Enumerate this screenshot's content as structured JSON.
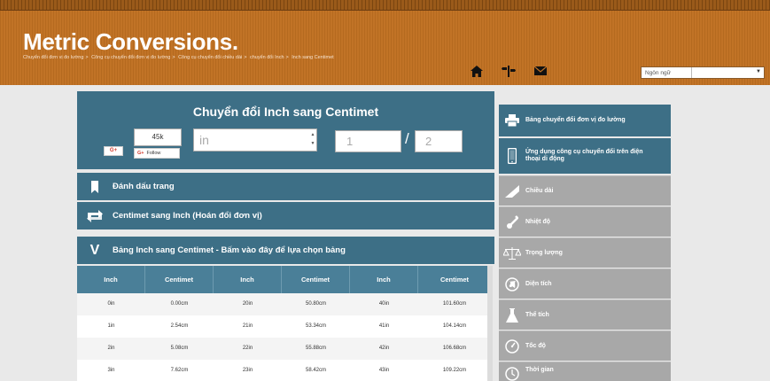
{
  "header": {
    "title": "Metric Conversions.",
    "breadcrumb": [
      "Chuyển đổi đơn vị đo lường",
      "Công cụ chuyển đổi đơn vị đo lường",
      "Công cụ chuyển đổi chiều dài",
      "chuyển đổi Inch",
      "Inch sang Centimet"
    ],
    "breadcrumb_sep": ">",
    "icons": [
      "home-icon",
      "signpost-icon",
      "mail-icon"
    ],
    "language_label": "Ngôn ngữ",
    "language_value": ""
  },
  "converter": {
    "title": "Chuyển đổi Inch sang Centimet",
    "share_count": "45k",
    "gplus_label": "G+",
    "follow_g": "G+",
    "follow_label": "Follow",
    "input_placeholder": "in",
    "numerator_placeholder": "1",
    "fraction_slash": "/",
    "denominator_placeholder": "2"
  },
  "bars": {
    "bookmark": "Đánh dấu trang",
    "swap": "Centimet sang Inch (Hoán đổi đơn vị)",
    "table_icon_letter": "V",
    "table": "Bảng Inch sang Centimet - Bấm vào đây để lựa chọn bảng"
  },
  "table": {
    "headers": [
      "Inch",
      "Centimet",
      "Inch",
      "Centimet",
      "Inch",
      "Centimet"
    ],
    "rows": [
      [
        "0in",
        "0.00cm",
        "20in",
        "50.80cm",
        "40in",
        "101.60cm"
      ],
      [
        "1in",
        "2.54cm",
        "21in",
        "53.34cm",
        "41in",
        "104.14cm"
      ],
      [
        "2in",
        "5.08cm",
        "22in",
        "55.88cm",
        "42in",
        "106.68cm"
      ],
      [
        "3in",
        "7.62cm",
        "23in",
        "58.42cm",
        "43in",
        "109.22cm"
      ]
    ]
  },
  "sidebar": {
    "items": [
      {
        "label": "Bảng chuyển đổi đơn vị đo lường",
        "icon": "printer-icon",
        "style": "blue"
      },
      {
        "label": "Ứng dụng công cụ chuyển đổi trên điện thoại di động",
        "icon": "phone-icon",
        "style": "blue"
      },
      {
        "label": "Chiều dài",
        "icon": "ruler-triangle-icon",
        "style": "gray"
      },
      {
        "label": "Nhiệt độ",
        "icon": "thermometer-icon",
        "style": "gray"
      },
      {
        "label": "Trọng lượng",
        "icon": "scales-icon",
        "style": "gray"
      },
      {
        "label": "Diện tích",
        "icon": "globe-icon",
        "style": "gray"
      },
      {
        "label": "Thể tích",
        "icon": "flask-icon",
        "style": "gray"
      },
      {
        "label": "Tốc độ",
        "icon": "speedometer-icon",
        "style": "gray"
      },
      {
        "label": "Thời gian",
        "icon": "clock-icon",
        "style": "gray"
      }
    ]
  },
  "colors": {
    "header_orange": "#c17326",
    "panel_blue": "#3d6f86",
    "sidebar_gray": "#a8a8a8"
  }
}
